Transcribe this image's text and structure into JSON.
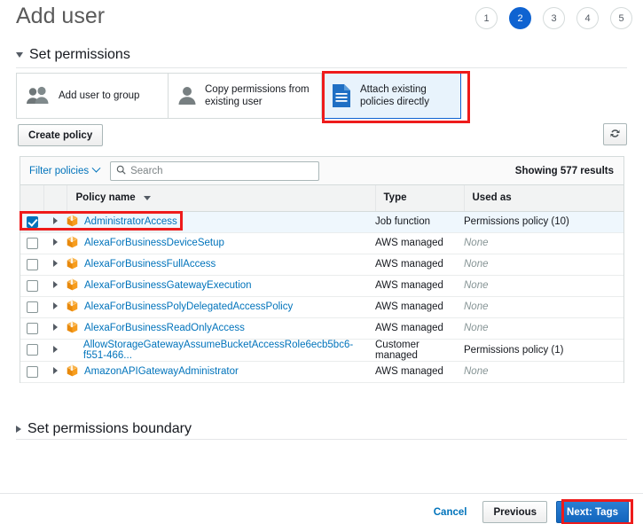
{
  "header": {
    "title": "Add user",
    "steps": [
      {
        "label": "1",
        "active": false
      },
      {
        "label": "2",
        "active": true
      },
      {
        "label": "3",
        "active": false
      },
      {
        "label": "4",
        "active": false
      },
      {
        "label": "5",
        "active": false
      }
    ]
  },
  "sections": {
    "set_permissions": "Set permissions",
    "permissions_boundary": "Set permissions boundary"
  },
  "permission_cards": [
    {
      "label": "Add user to group",
      "icon": "users-group-icon",
      "selected": false
    },
    {
      "label": "Copy permissions from existing user",
      "icon": "person-icon",
      "selected": false
    },
    {
      "label": "Attach existing policies directly",
      "icon": "document-icon",
      "selected": true
    }
  ],
  "toolbar": {
    "create_policy_label": "Create policy",
    "refresh_icon": "refresh-icon"
  },
  "filter": {
    "filter_policies_label": "Filter policies",
    "search_placeholder": "Search",
    "search_value": "",
    "results_text": "Showing 577 results"
  },
  "table": {
    "columns": [
      "Policy name",
      "Type",
      "Used as"
    ],
    "sort_column": "Policy name",
    "rows": [
      {
        "checked": true,
        "icon": "package-icon",
        "name": "AdministratorAccess",
        "type": "Job function",
        "used_as": "Permissions policy (10)",
        "used_none": false
      },
      {
        "checked": false,
        "icon": "package-icon",
        "name": "AlexaForBusinessDeviceSetup",
        "type": "AWS managed",
        "used_as": "None",
        "used_none": true
      },
      {
        "checked": false,
        "icon": "package-icon",
        "name": "AlexaForBusinessFullAccess",
        "type": "AWS managed",
        "used_as": "None",
        "used_none": true
      },
      {
        "checked": false,
        "icon": "package-icon",
        "name": "AlexaForBusinessGatewayExecution",
        "type": "AWS managed",
        "used_as": "None",
        "used_none": true
      },
      {
        "checked": false,
        "icon": "package-icon",
        "name": "AlexaForBusinessPolyDelegatedAccessPolicy",
        "type": "AWS managed",
        "used_as": "None",
        "used_none": true
      },
      {
        "checked": false,
        "icon": "package-icon",
        "name": "AlexaForBusinessReadOnlyAccess",
        "type": "AWS managed",
        "used_as": "None",
        "used_none": true
      },
      {
        "checked": false,
        "icon": "none",
        "name": "AllowStorageGatewayAssumeBucketAccessRole6ecb5bc6-f551-466...",
        "type": "Customer managed",
        "used_as": "Permissions policy (1)",
        "used_none": false
      },
      {
        "checked": false,
        "icon": "package-icon",
        "name": "AmazonAPIGatewayAdministrator",
        "type": "AWS managed",
        "used_as": "None",
        "used_none": true
      }
    ]
  },
  "footer": {
    "cancel_label": "Cancel",
    "previous_label": "Previous",
    "next_label": "Next: Tags"
  },
  "colors": {
    "accent_blue": "#0f63d1",
    "link_blue": "#0073bb",
    "selected_card_bg": "#e8f3fc",
    "selected_row_bg": "#eff7fd",
    "annotation_red": "#ee1b1b",
    "package_orange": "#f79d1e"
  }
}
